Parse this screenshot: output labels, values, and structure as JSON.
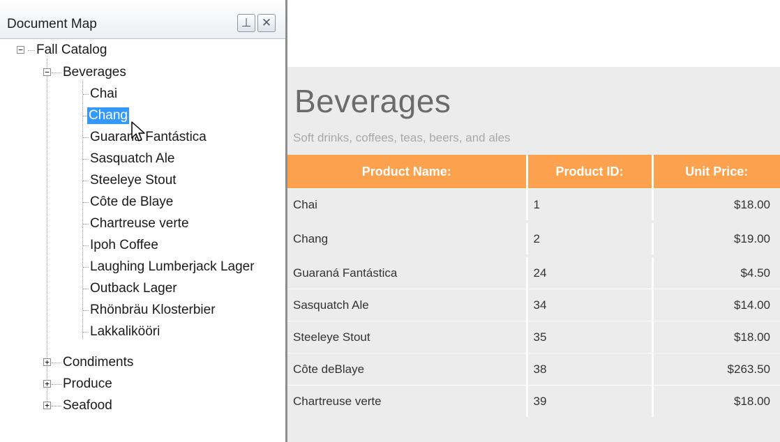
{
  "document_map": {
    "title": "Document Map",
    "buttons": {
      "pin_icon": "pin-icon",
      "close_icon": "close-icon"
    },
    "tree": {
      "root": "Fall Catalog",
      "groups": [
        {
          "label": "Beverages",
          "expanded": true,
          "items": [
            "Chai",
            "Chang",
            "Guaraná Fantástica",
            "Sasquatch Ale",
            "Steeleye Stout",
            "Côte de Blaye",
            "Chartreuse verte",
            "Ipoh Coffee",
            "Laughing Lumberjack Lager",
            "Outback Lager",
            "Rhönbräu Klosterbier",
            "Lakkalikööri"
          ]
        },
        {
          "label": "Condiments",
          "expanded": false
        },
        {
          "label": "Produce",
          "expanded": false
        },
        {
          "label": "Seafood",
          "expanded": false
        }
      ],
      "selected": "Chang"
    }
  },
  "report": {
    "title": "Beverages",
    "subtitle": "Soft drinks, coffees, teas, beers, and ales",
    "columns": [
      "Product Name:",
      "Product ID:",
      "Unit Price:"
    ],
    "rows": [
      [
        "Chai",
        "1",
        "$18.00"
      ],
      [
        "Chang",
        "2",
        "$19.00"
      ],
      [
        "Guaraná Fantástica",
        "24",
        "$4.50"
      ],
      [
        "Sasquatch Ale",
        "34",
        "$14.00"
      ],
      [
        "Steeleye Stout",
        "35",
        "$18.00"
      ],
      [
        "Côte deBlaye",
        "38",
        "$263.50"
      ],
      [
        "Chartreuse verte",
        "39",
        "$18.00"
      ]
    ],
    "colors": {
      "header": "#fca24e",
      "selection": "#3399ff"
    }
  }
}
